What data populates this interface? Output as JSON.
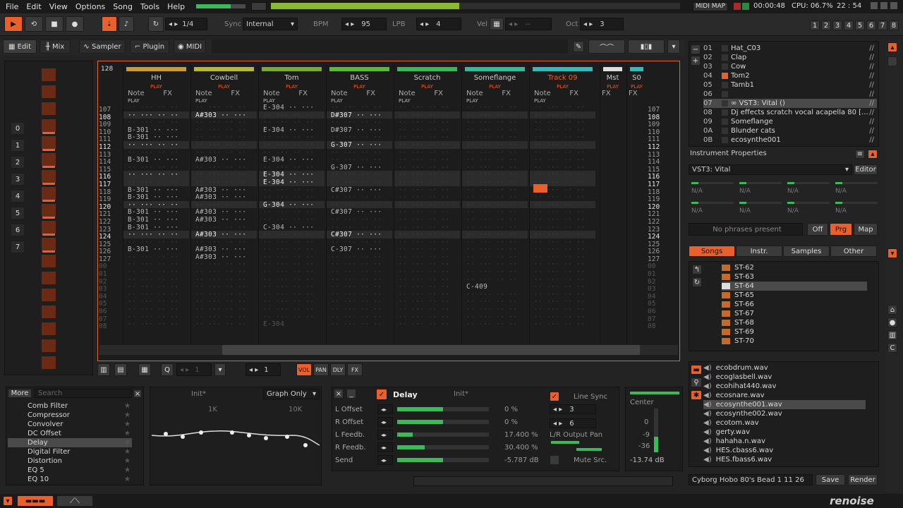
{
  "menu": [
    "File",
    "Edit",
    "View",
    "Options",
    "Song",
    "Tools",
    "Help"
  ],
  "toolbar": {
    "pattern_pos": "1/4",
    "sync_label": "Sync",
    "sync_value": "Internal",
    "bpm_label": "BPM",
    "bpm": "95",
    "lpb_label": "LPB",
    "lpb": "4",
    "vel_label": "Vel",
    "vel": "--",
    "oct_label": "Oct",
    "oct": "3",
    "midi_map": "MIDI MAP",
    "time": "00:00:48",
    "cpu": "CPU: 06.7%",
    "clock": "22 : 54",
    "tracks": [
      "1",
      "2",
      "3",
      "4",
      "5",
      "6",
      "7",
      "8"
    ]
  },
  "tabs": {
    "edit": "Edit",
    "mix": "Mix",
    "sampler": "Sampler",
    "plugin": "Plugin",
    "midi": "MIDI"
  },
  "seq": {
    "length": "128",
    "numbers": [
      "0",
      "1",
      "2",
      "3",
      "4",
      "5",
      "6",
      "7"
    ],
    "slots": [
      "0",
      "1",
      "2",
      "3",
      "4",
      "5",
      "0",
      "5"
    ]
  },
  "tracks": [
    {
      "name": "HH",
      "color": "#c89a3a",
      "c1": "Note",
      "c2": "FX",
      "rows": [
        "",
        "·· ··· ·· ··",
        "",
        "B-301 ·· ···",
        "B-301 ·· ···",
        "·· ··· ·· ··",
        "",
        "B-301 ·· ···",
        "",
        "·· ··· ·· ··",
        "",
        "B-301 ·· ···",
        "B-301 ·· ···",
        "·· ··· ·· ··",
        "B-301 ·· ···",
        "B-301 ·· ···",
        "B-301 ·· ···",
        "·· ··· ·· ··",
        "",
        "B-301 ·· ···",
        "",
        ""
      ]
    },
    {
      "name": "Cowbell",
      "color": "#b7b83a",
      "c1": "Note",
      "c2": "FX",
      "rows": [
        "",
        "A#303 ·· ···",
        "",
        "",
        "",
        "",
        "",
        "A#303 ·· ···",
        "",
        "",
        "",
        "A#303 ·· ···",
        "A#303 ·· ···",
        "",
        "A#303 ·· ···",
        "A#303 ·· ···",
        "",
        "A#303 ·· ···",
        "",
        "A#303 ·· ···",
        "A#303 ·· ···"
      ]
    },
    {
      "name": "Tom",
      "color": "#7aa83a",
      "c1": "Note",
      "c2": "FX",
      "rows": [
        "E-304 ·· ···",
        "",
        "",
        "E-304 ·· ···",
        "",
        "",
        "",
        "E-304 ·· ···",
        "",
        "E-304 ·· ···",
        "E-304 ·· ···",
        "",
        "",
        "G-304 ·· ···",
        "",
        "",
        "C-304 ·· ···",
        "",
        "",
        "",
        "",
        "",
        "",
        "",
        "",
        "",
        "",
        "",
        "",
        "E-304",
        "",
        "E-304"
      ]
    },
    {
      "name": "BASS",
      "color": "#5ab83a",
      "c1": "Note",
      "c2": "FX",
      "rows": [
        "",
        "D#307 ·· ···",
        "",
        "D#307 ·· ···",
        "",
        "G-307 ·· ···",
        "",
        "",
        "G-307 ·· ···",
        "",
        "",
        "C#307 ·· ···",
        "",
        "",
        "C#307 ·· ···",
        "",
        "",
        "C#307 ·· ···",
        "",
        "C-307 ·· ···"
      ]
    },
    {
      "name": "Scratch",
      "color": "#3ab85a",
      "c1": "Note",
      "c2": "FX",
      "rows": []
    },
    {
      "name": "Someflange",
      "color": "#3ab89a",
      "c1": "Note",
      "c2": "FX",
      "rows": [
        "",
        "",
        "",
        "",
        "",
        "",
        "",
        "",
        "",
        "",
        "",
        "",
        "",
        "",
        "",
        "",
        "",
        "",
        "",
        "",
        "",
        "",
        "",
        "",
        "C-409"
      ]
    },
    {
      "name": "Track 09",
      "color": "#3ab8b8",
      "c1": "Note",
      "c2": "FX",
      "rows": []
    }
  ],
  "extra_tracks": {
    "mst": "Mst",
    "s0": "S0",
    "fx": "FX",
    "play": "PLAY"
  },
  "line_numbers": [
    "107",
    "108",
    "109",
    "110",
    "111",
    "112",
    "113",
    "114",
    "115",
    "116",
    "117",
    "118",
    "119",
    "120",
    "121",
    "122",
    "123",
    "124",
    "125",
    "126",
    "127",
    "00",
    "01",
    "02",
    "03",
    "04",
    "05",
    "06",
    "07",
    "08"
  ],
  "instruments": [
    {
      "num": "01",
      "name": "Hat_C03"
    },
    {
      "num": "02",
      "name": "Clap"
    },
    {
      "num": "03",
      "name": "Cow"
    },
    {
      "num": "04",
      "name": "Tom2"
    },
    {
      "num": "05",
      "name": "Tamb1"
    },
    {
      "num": "06",
      "name": ""
    },
    {
      "num": "07",
      "name": "∞ VST3: Vital ()"
    },
    {
      "num": "08",
      "name": "Dj effects scratch vocal acapella 80 [..."
    },
    {
      "num": "09",
      "name": "Someflange"
    },
    {
      "num": "0A",
      "name": "Blunder cats"
    },
    {
      "num": "0B",
      "name": "ecosynthe001"
    }
  ],
  "instr_props": {
    "title": "Instrument Properties",
    "plugin": "VST3: Vital",
    "editor": "Editor",
    "na": "N/A",
    "phrases": "No phrases present",
    "off": "Off",
    "prg": "Prg",
    "map": "Map"
  },
  "browser": {
    "tabs": [
      "Songs",
      "Instr.",
      "Samples",
      "Other"
    ],
    "folders": [
      "ST-62",
      "ST-63",
      "ST-64",
      "ST-65",
      "ST-66",
      "ST-67",
      "ST-68",
      "ST-69",
      "ST-70"
    ],
    "files": [
      "ecobdrum.wav",
      "ecoglasbell.wav",
      "ecohihat440.wav",
      "ecosnare.wav",
      "ecosynthe001.wav",
      "ecosynthe002.wav",
      "ecotom.wav",
      "gerty.wav",
      "hahaha.n.wav",
      "HES.cbass6.wav",
      "HES.fbass6.wav"
    ],
    "filename": "Cyborg Hobo 80's Bead 1 11 26",
    "save": "Save",
    "render": "Render"
  },
  "bottombar": {
    "q": "1",
    "step": "1",
    "vol": "VOL",
    "pan": "PAN",
    "dly": "DLY",
    "fx": "FX"
  },
  "effects": {
    "more": "More",
    "search": "Search",
    "list": [
      "Comb Filter",
      "Compressor",
      "Convolver",
      "DC Offset",
      "Delay",
      "Digital Filter",
      "Distortion",
      "EQ 5",
      "EQ 10"
    ]
  },
  "eq": {
    "preset": "Init*",
    "mode": "Graph Only",
    "f1": "1K",
    "f2": "10K"
  },
  "delay": {
    "title": "Delay",
    "preset": "Init*",
    "params": [
      {
        "name": "L Offset",
        "value": "0 %",
        "level": 0.5
      },
      {
        "name": "R Offset",
        "value": "0 %",
        "level": 0.5
      },
      {
        "name": "L Feedb.",
        "value": "17.400 %",
        "level": 0.17
      },
      {
        "name": "R Feedb.",
        "value": "30.400 %",
        "level": 0.3
      },
      {
        "name": "Send",
        "value": "-5.787 dB",
        "level": 0.5
      }
    ],
    "linesync": "Line Sync",
    "v1": "3",
    "v2": "6",
    "lr": "L/R Output Pan",
    "mute": "Mute Src."
  },
  "mixer": {
    "center": "Center",
    "m0": "0",
    "m9": "-9",
    "m36": "-36",
    "db": "-13.74 dB"
  },
  "logo": "renoise"
}
